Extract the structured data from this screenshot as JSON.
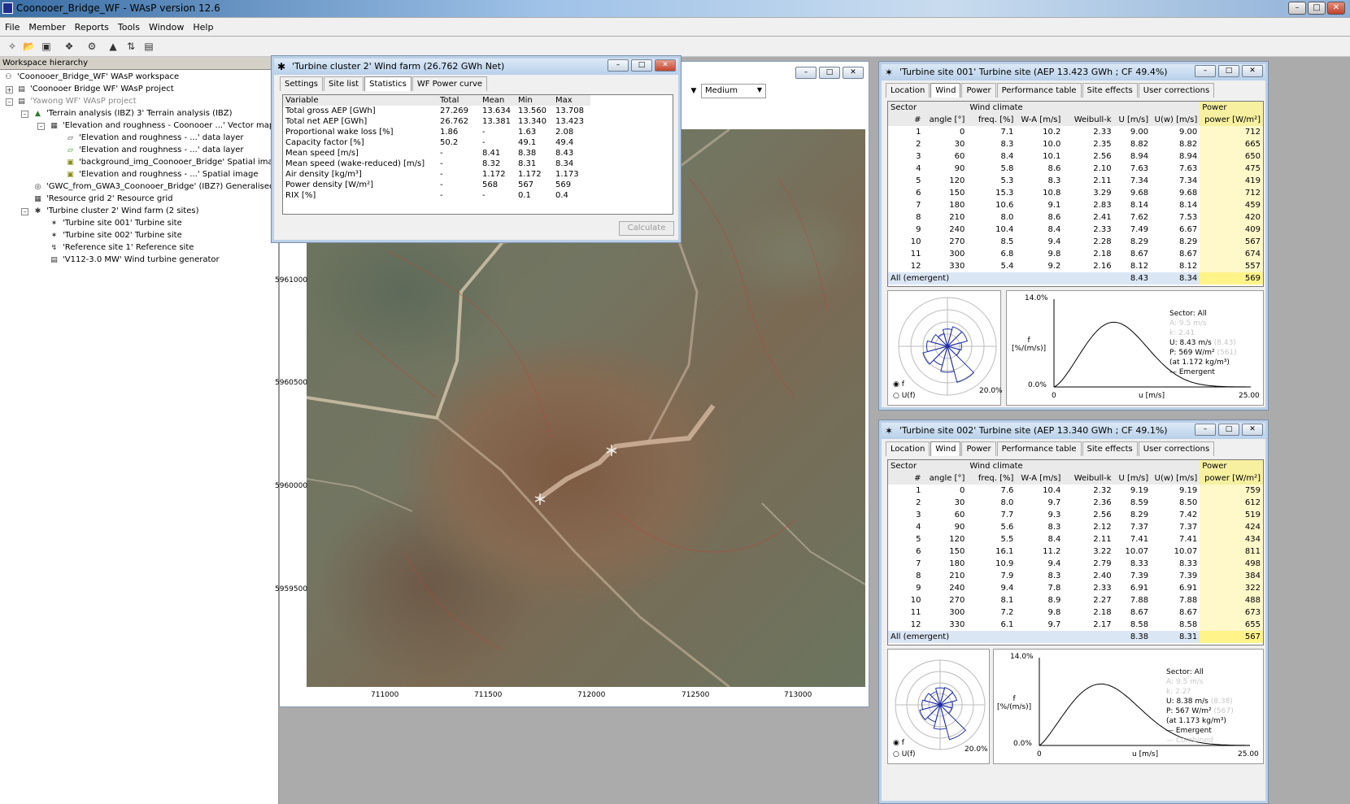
{
  "app": {
    "title": "Coonooer_Bridge_WF - WAsP version 12.6"
  },
  "menu": [
    "File",
    "Member",
    "Reports",
    "Tools",
    "Window",
    "Help"
  ],
  "workspace": {
    "header": "Workspace hierarchy",
    "items": [
      "'Coonooer_Bridge_WF' WAsP workspace",
      "'Coonooer Bridge WF' WAsP project",
      "'Yawong WF' WAsP project",
      "'Terrain analysis (IBZ) 3' Terrain analysis (IBZ)",
      "'Elevation and roughness - Coonooer ...' Vector map",
      "'Elevation and roughness - ...' data layer",
      "'Elevation and roughness - ...' data layer",
      "'background_img_Coonooer_Bridge' Spatial image",
      "'Elevation and roughness - ...' Spatial image",
      "'GWC_from_GWA3_Coonooer_Bridge' (IBZ?) Generalised w",
      "'Resource grid 2' Resource grid",
      "'Turbine cluster 2' Wind farm (2 sites)",
      "'Turbine site 001' Turbine site",
      "'Turbine site 002' Turbine site",
      "'Reference site 1' Reference site",
      "'V112-3.0 MW' Wind turbine generator"
    ]
  },
  "windfarm": {
    "title": "'Turbine cluster 2' Wind farm (26.762 GWh Net)",
    "tabs": [
      "Settings",
      "Site list",
      "Statistics",
      "WF Power curve"
    ],
    "columns": [
      "Variable",
      "Total",
      "Mean",
      "Min",
      "Max"
    ],
    "rows": [
      [
        "Total gross AEP [GWh]",
        "27.269",
        "13.634",
        "13.560",
        "13.708"
      ],
      [
        "Total net AEP [GWh]",
        "26.762",
        "13.381",
        "13.340",
        "13.423"
      ],
      [
        "Proportional wake loss [%]",
        "1.86",
        "-",
        "1.63",
        "2.08"
      ],
      [
        "Capacity factor [%]",
        "50.2",
        "-",
        "49.1",
        "49.4"
      ],
      [
        "Mean speed [m/s]",
        "-",
        "8.41",
        "8.38",
        "8.43"
      ],
      [
        "Mean speed (wake-reduced) [m/s]",
        "-",
        "8.32",
        "8.31",
        "8.34"
      ],
      [
        "Air density [kg/m³]",
        "-",
        "1.172",
        "1.172",
        "1.173"
      ],
      [
        "Power density [W/m²]",
        "-",
        "568",
        "567",
        "569"
      ],
      [
        "RIX [%]",
        "-",
        "-",
        "0.1",
        "0.4"
      ]
    ],
    "calculate": "Calculate"
  },
  "map": {
    "dropdown": "Medium",
    "yticks": [
      "5961000",
      "5960500",
      "5960000",
      "5959500"
    ],
    "xticks": [
      "711000",
      "711500",
      "712000",
      "712500",
      "713000"
    ]
  },
  "site1": {
    "title": "'Turbine site 001' Turbine site (AEP 13.423 GWh ; CF 49.4%)",
    "tabs": [
      "Location",
      "Wind",
      "Power",
      "Performance table",
      "Site effects",
      "User corrections"
    ],
    "group_sector": "Sector",
    "group_wind": "Wind climate",
    "group_power": "Power",
    "columns": [
      "#",
      "angle [°]",
      "freq. [%]",
      "W-A [m/s]",
      "Weibull-k",
      "U [m/s]",
      "U(w) [m/s]",
      "power [W/m²]"
    ],
    "rows": [
      [
        "1",
        "0",
        "7.1",
        "10.2",
        "2.33",
        "9.00",
        "9.00",
        "712"
      ],
      [
        "2",
        "30",
        "8.3",
        "10.0",
        "2.35",
        "8.82",
        "8.82",
        "665"
      ],
      [
        "3",
        "60",
        "8.4",
        "10.1",
        "2.56",
        "8.94",
        "8.94",
        "650"
      ],
      [
        "4",
        "90",
        "5.8",
        "8.6",
        "2.10",
        "7.63",
        "7.63",
        "475"
      ],
      [
        "5",
        "120",
        "5.3",
        "8.3",
        "2.11",
        "7.34",
        "7.34",
        "419"
      ],
      [
        "6",
        "150",
        "15.3",
        "10.8",
        "3.29",
        "9.68",
        "9.68",
        "712"
      ],
      [
        "7",
        "180",
        "10.6",
        "9.1",
        "2.83",
        "8.14",
        "8.14",
        "459"
      ],
      [
        "8",
        "210",
        "8.0",
        "8.6",
        "2.41",
        "7.62",
        "7.53",
        "420"
      ],
      [
        "9",
        "240",
        "10.4",
        "8.4",
        "2.33",
        "7.49",
        "6.67",
        "409"
      ],
      [
        "10",
        "270",
        "8.5",
        "9.4",
        "2.28",
        "8.29",
        "8.29",
        "567"
      ],
      [
        "11",
        "300",
        "6.8",
        "9.8",
        "2.18",
        "8.67",
        "8.67",
        "674"
      ],
      [
        "12",
        "330",
        "5.4",
        "9.2",
        "2.16",
        "8.12",
        "8.12",
        "557"
      ]
    ],
    "all_label": "All (emergent)",
    "all_u": "8.43",
    "all_uw": "8.34",
    "all_power": "569",
    "chart": {
      "ymax": "14.0%",
      "ymin": "0.0%",
      "xmin": "0",
      "xmax": "25.00",
      "xlabel": "u [m/s]",
      "ylabel": "f\n[%/(m/s)]",
      "rose_scale": "20.0%",
      "radio_f": "f",
      "radio_u": "U(f)",
      "sector": "Sector: All",
      "A": "A: 9.5 m/s",
      "k": "k: 2.41",
      "U": "U: 8.43 m/s",
      "U_ghost": "(8.43)",
      "P": "P: 569 W/m²",
      "P_ghost": "(561)",
      "rho": "(at 1.172 kg/m³)",
      "emergent": "Emergent"
    }
  },
  "site2": {
    "title": "'Turbine site 002' Turbine site (AEP 13.340 GWh ; CF 49.1%)",
    "tabs": [
      "Location",
      "Wind",
      "Power",
      "Performance table",
      "Site effects",
      "User corrections"
    ],
    "group_sector": "Sector",
    "group_wind": "Wind climate",
    "group_power": "Power",
    "columns": [
      "#",
      "angle [°]",
      "freq. [%]",
      "W-A [m/s]",
      "Weibull-k",
      "U [m/s]",
      "U(w) [m/s]",
      "power [W/m²]"
    ],
    "rows": [
      [
        "1",
        "0",
        "7.6",
        "10.4",
        "2.32",
        "9.19",
        "9.19",
        "759"
      ],
      [
        "2",
        "30",
        "8.0",
        "9.7",
        "2.36",
        "8.59",
        "8.50",
        "612"
      ],
      [
        "3",
        "60",
        "7.7",
        "9.3",
        "2.56",
        "8.29",
        "7.42",
        "519"
      ],
      [
        "4",
        "90",
        "5.6",
        "8.3",
        "2.12",
        "7.37",
        "7.37",
        "424"
      ],
      [
        "5",
        "120",
        "5.5",
        "8.4",
        "2.11",
        "7.41",
        "7.41",
        "434"
      ],
      [
        "6",
        "150",
        "16.1",
        "11.2",
        "3.22",
        "10.07",
        "10.07",
        "811"
      ],
      [
        "7",
        "180",
        "10.9",
        "9.4",
        "2.79",
        "8.33",
        "8.33",
        "498"
      ],
      [
        "8",
        "210",
        "7.9",
        "8.3",
        "2.40",
        "7.39",
        "7.39",
        "384"
      ],
      [
        "9",
        "240",
        "9.4",
        "7.8",
        "2.33",
        "6.91",
        "6.91",
        "322"
      ],
      [
        "10",
        "270",
        "8.1",
        "8.9",
        "2.27",
        "7.88",
        "7.88",
        "488"
      ],
      [
        "11",
        "300",
        "7.2",
        "9.8",
        "2.18",
        "8.67",
        "8.67",
        "673"
      ],
      [
        "12",
        "330",
        "6.1",
        "9.7",
        "2.17",
        "8.58",
        "8.58",
        "655"
      ]
    ],
    "all_label": "All (emergent)",
    "all_u": "8.38",
    "all_uw": "8.31",
    "all_power": "567",
    "chart": {
      "ymax": "14.0%",
      "ymin": "0.0%",
      "xmin": "0",
      "xmax": "25.00",
      "xlabel": "u [m/s]",
      "ylabel": "f\n[%/(m/s)]",
      "rose_scale": "20.0%",
      "radio_f": "f",
      "radio_u": "U(f)",
      "sector": "Sector: All",
      "A": "A: 9.5 m/s",
      "k": "k: 2.2?",
      "U": "U: 8.38 m/s",
      "U_ghost": "(8.38)",
      "P": "P: 567 W/m²",
      "P_ghost": "(567)",
      "rho": "(at 1.173 kg/m³)",
      "emergent": "Emergent",
      "combined": "Combined"
    }
  }
}
